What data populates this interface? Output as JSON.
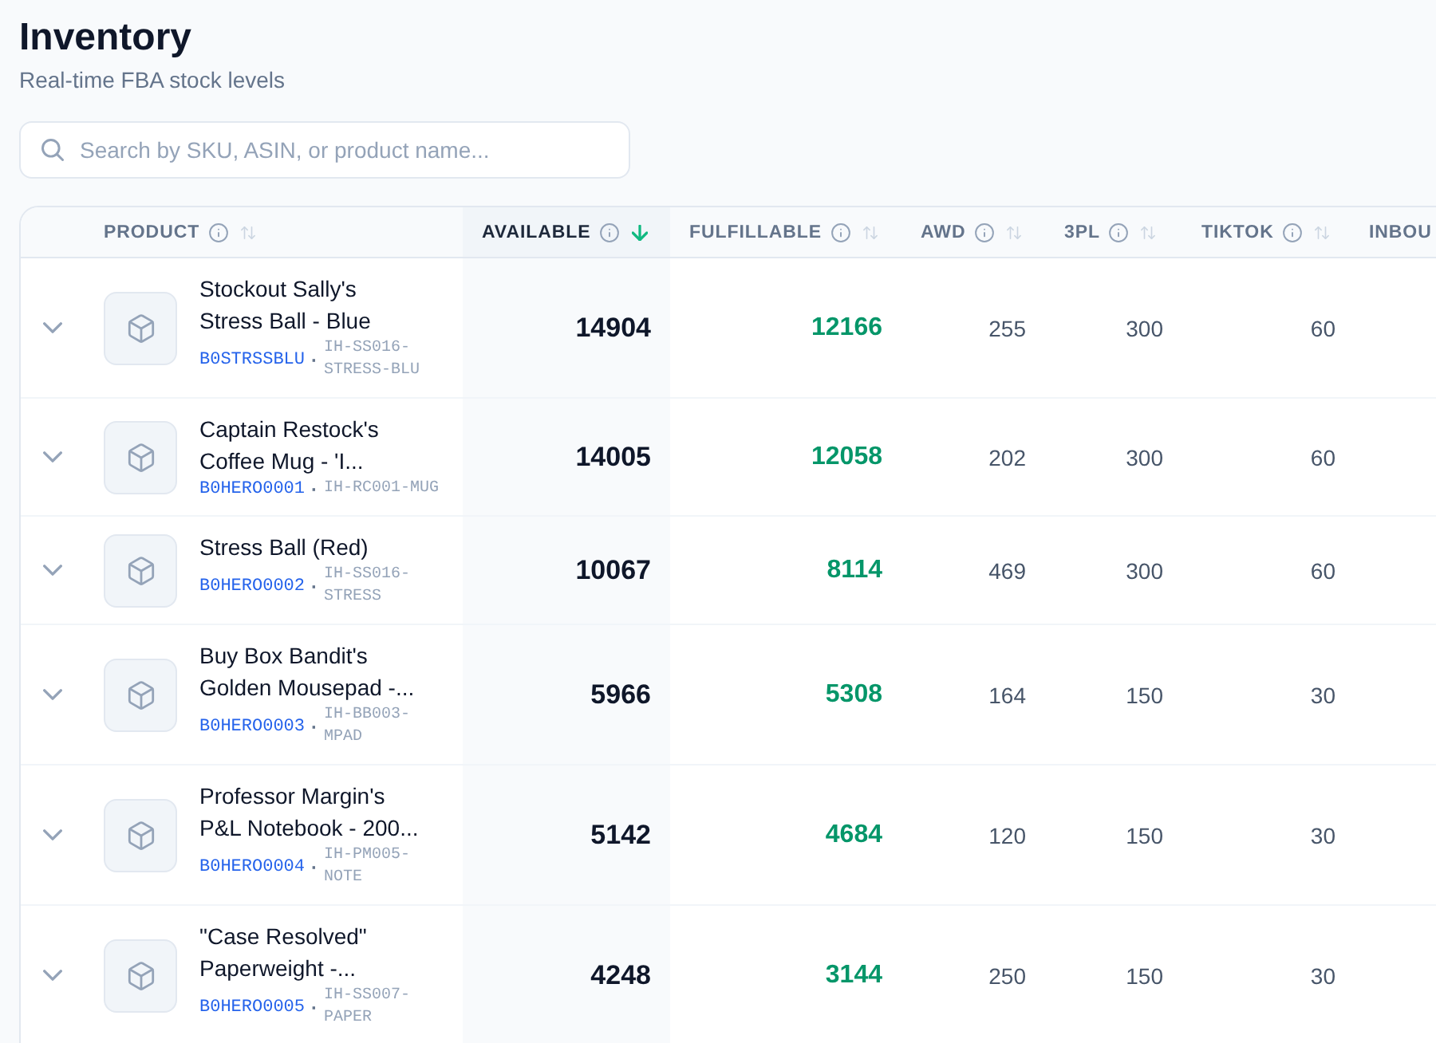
{
  "page": {
    "title": "Inventory",
    "subtitle": "Real-time FBA stock levels"
  },
  "search": {
    "placeholder": "Search by SKU, ASIN, or product name..."
  },
  "table": {
    "columns": [
      {
        "label": "PRODUCT",
        "kind": "product",
        "info": true,
        "sorted": false
      },
      {
        "label": "AVAILABLE",
        "kind": "total",
        "info": true,
        "sorted": true
      },
      {
        "label": "FULFILLABLE",
        "kind": "fulfillable",
        "info": true,
        "sorted": false
      },
      {
        "label": "AWD",
        "kind": "count",
        "info": true,
        "sorted": false
      },
      {
        "label": "3PL",
        "kind": "count",
        "info": true,
        "sorted": false
      },
      {
        "label": "TIKTOK",
        "kind": "count",
        "info": true,
        "sorted": false
      },
      {
        "label": "INBOU"
      }
    ],
    "rows": [
      {
        "expanded": false,
        "name": "Stockout Sally's Stress Ball - Blue",
        "asin": "B0STRSSBLU",
        "separator": "·",
        "sku": "IH-SS016-STRESS-BLU",
        "values": [
          "14904",
          "12166",
          "255",
          "300",
          "60"
        ]
      },
      {
        "expanded": false,
        "name": "Captain Restock's Coffee Mug - 'I...",
        "asin": "B0HERO0001",
        "separator": "·",
        "sku": "IH-RC001-MUG",
        "values": [
          "14005",
          "12058",
          "202",
          "300",
          "60"
        ]
      },
      {
        "expanded": false,
        "name": "Stress Ball (Red)",
        "asin": "B0HERO0002",
        "separator": "·",
        "sku": "IH-SS016-STRESS",
        "values": [
          "10067",
          "8114",
          "469",
          "300",
          "60"
        ]
      },
      {
        "expanded": false,
        "name": "Buy Box Bandit's Golden Mousepad -...",
        "asin": "B0HERO0003",
        "separator": "·",
        "sku": "IH-BB003-MPAD",
        "values": [
          "5966",
          "5308",
          "164",
          "150",
          "30"
        ]
      },
      {
        "expanded": false,
        "name": "Professor Margin's P&L Notebook - 200...",
        "asin": "B0HERO0004",
        "separator": "·",
        "sku": "IH-PM005-NOTE",
        "values": [
          "5142",
          "4684",
          "120",
          "150",
          "30"
        ]
      },
      {
        "expanded": false,
        "name": "\"Case Resolved\" Paperweight -...",
        "asin": "B0HERO0005",
        "separator": "·",
        "sku": "IH-SS007-PAPER",
        "values": [
          "4248",
          "3144",
          "250",
          "150",
          "30"
        ]
      }
    ]
  }
}
